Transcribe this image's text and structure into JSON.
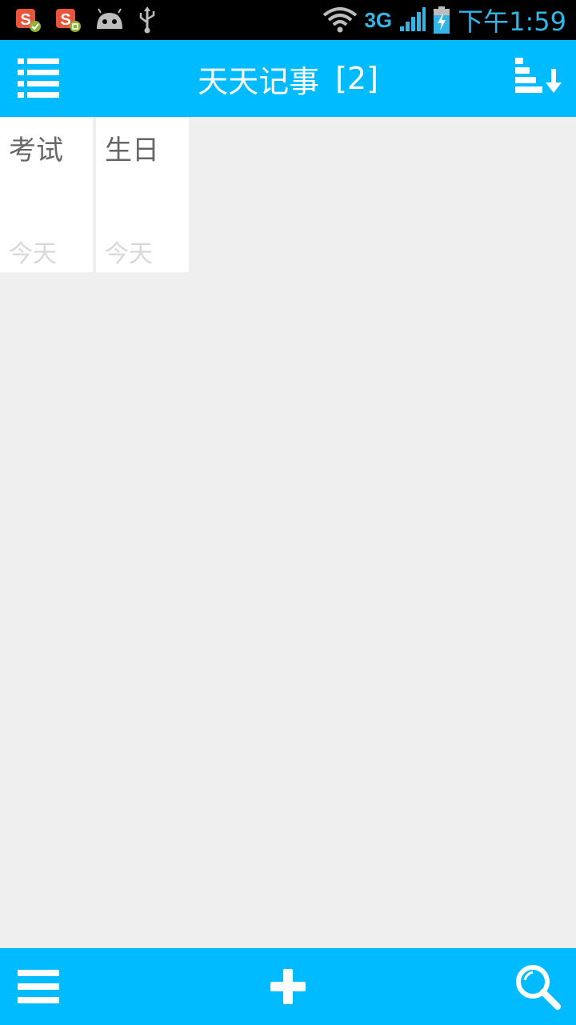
{
  "status_bar": {
    "network": "3G",
    "time": "下午1:59",
    "icons": [
      "sogou-input-icon",
      "sogou-input-icon",
      "android-icon",
      "usb-icon",
      "wifi-icon",
      "signal-icon",
      "battery-charging-icon"
    ]
  },
  "header": {
    "title": "天天记事",
    "count": "[2]",
    "menu_icon": "list-icon",
    "sort_icon": "sort-descending-icon"
  },
  "notes": [
    {
      "title": "考试",
      "date": "今天"
    },
    {
      "title": "生日",
      "date": "今天"
    }
  ],
  "bottom_bar": {
    "menu_icon": "hamburger-icon",
    "add_icon": "plus-icon",
    "search_icon": "search-icon"
  },
  "colors": {
    "accent": "#00bbff",
    "status_text": "#33b5e5",
    "background": "#efefef"
  }
}
